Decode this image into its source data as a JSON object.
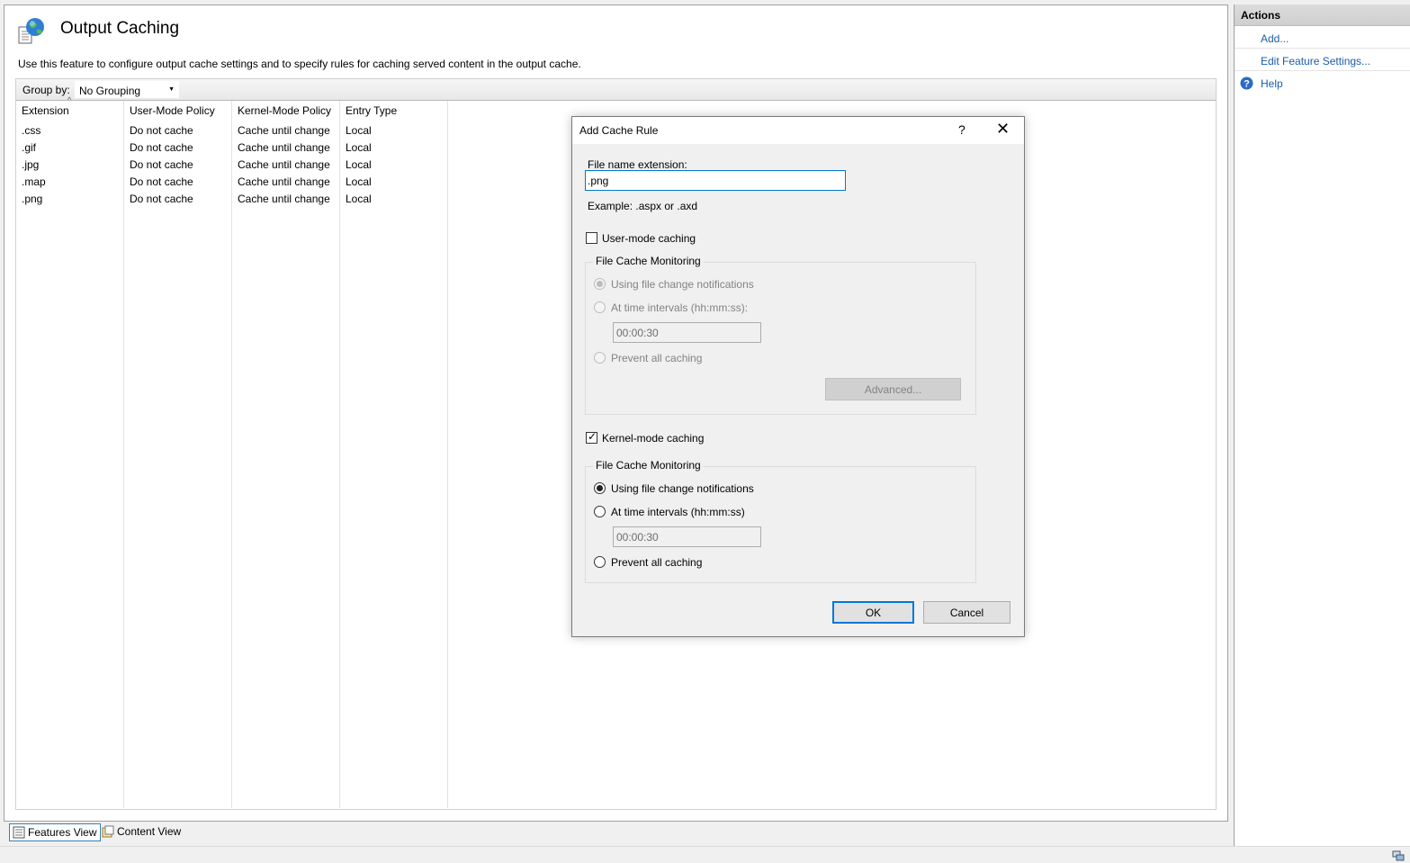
{
  "feature": {
    "title": "Output Caching",
    "description": "Use this feature to configure output cache settings and to specify rules for caching served content in the output cache.",
    "icon": "globe-document-icon"
  },
  "groupby": {
    "label": "Group by:",
    "value": "No Grouping"
  },
  "table": {
    "columns": [
      "Extension",
      "User-Mode Policy",
      "Kernel-Mode Policy",
      "Entry Type"
    ],
    "rows": [
      [
        ".css",
        "Do not cache",
        "Cache until change",
        "Local"
      ],
      [
        ".gif",
        "Do not cache",
        "Cache until change",
        "Local"
      ],
      [
        ".jpg",
        "Do not cache",
        "Cache until change",
        "Local"
      ],
      [
        ".map",
        "Do not cache",
        "Cache until change",
        "Local"
      ],
      [
        ".png",
        "Do not cache",
        "Cache until change",
        "Local"
      ]
    ]
  },
  "tabs": {
    "features_view": "Features View",
    "content_view": "Content View"
  },
  "actions": {
    "header": "Actions",
    "add": "Add...",
    "edit_feature_settings": "Edit Feature Settings...",
    "help": "Help"
  },
  "dialog": {
    "title": "Add Cache Rule",
    "help_glyph": "?",
    "close_glyph": "✕",
    "ext_label": "File name extension:",
    "ext_value": ".png",
    "example": "Example: .aspx or .axd",
    "user_mode": {
      "label": "User-mode caching",
      "checked": false,
      "group_title": "File Cache Monitoring",
      "opt_notifications": "Using file change notifications",
      "opt_intervals": "At time intervals (hh:mm:ss):",
      "interval_value": "00:00:30",
      "opt_prevent": "Prevent all caching",
      "advanced": "Advanced..."
    },
    "kernel_mode": {
      "label": "Kernel-mode caching",
      "checked": true,
      "group_title": "File Cache Monitoring",
      "opt_notifications": "Using file change notifications",
      "opt_intervals": "At time intervals (hh:mm:ss)",
      "interval_value": "00:00:30",
      "opt_prevent": "Prevent all caching"
    },
    "ok": "OK",
    "cancel": "Cancel"
  },
  "colors": {
    "accent": "#0078d7",
    "link": "#1a5ea8"
  }
}
